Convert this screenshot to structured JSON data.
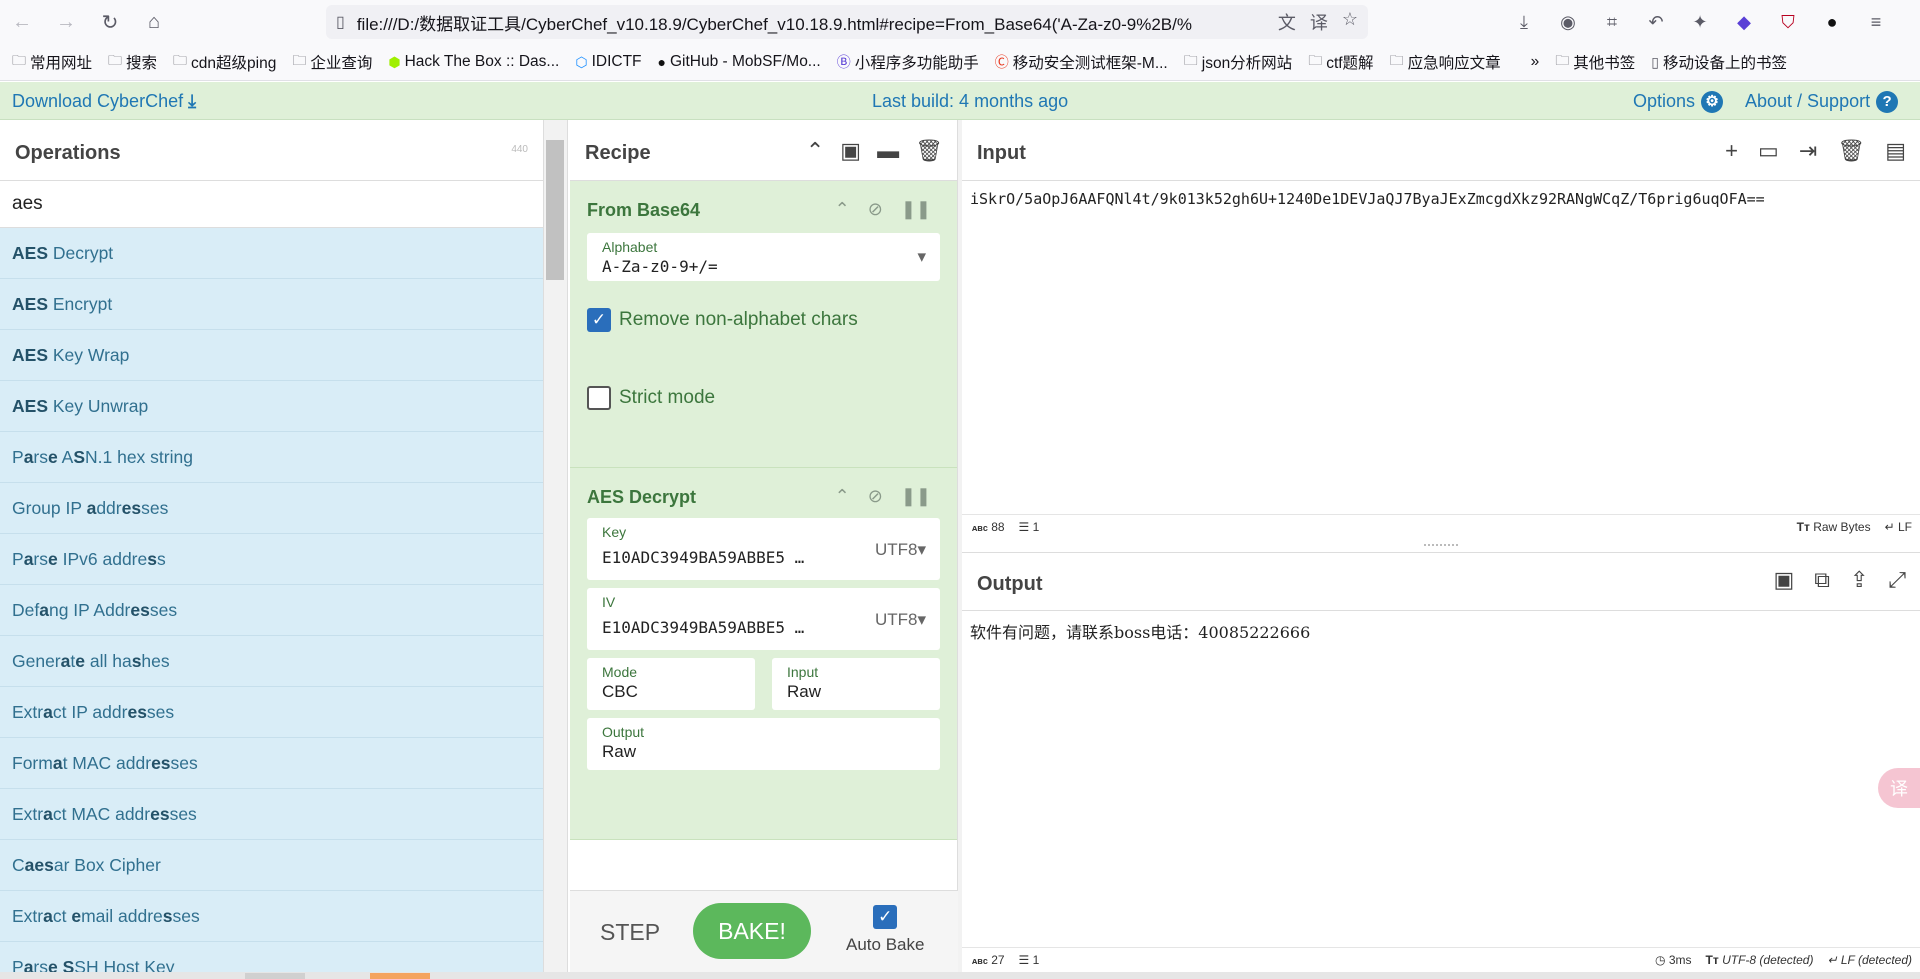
{
  "browser": {
    "url": "file:///D:/数据取证工具/CyberChef_v10.18.9/CyberChef_v10.18.9.html#recipe=From_Base64('A-Za-z0-9%2B/%",
    "bookmarks": [
      "常用网址",
      "搜索",
      "cdn超级ping",
      "企业查询",
      "Hack The Box :: Das...",
      "IDICTF",
      "GitHub - MobSF/Mo...",
      "小程序多功能助手",
      "移动安全测试框架-M...",
      "json分析网站",
      "ctf题解",
      "应急响应文章",
      "其他书签",
      "移动设备上的书签"
    ]
  },
  "banner": {
    "download": "Download CyberChef",
    "build": "Last build: 4 months ago",
    "options": "Options",
    "about": "About / Support"
  },
  "operations": {
    "title": "Operations",
    "count": "440",
    "search_value": "aes",
    "items": [
      "AES Decrypt",
      "AES Encrypt",
      "AES Key Wrap",
      "AES Key Unwrap",
      "Parse ASN.1 hex string",
      "Group IP addresses",
      "Parse IPv6 address",
      "Defang IP Addresses",
      "Generate all hashes",
      "Extract IP addresses",
      "Format MAC addresses",
      "Extract MAC addresses",
      "Caesar Box Cipher",
      "Extract email addresses",
      "Parse SSH Host Key"
    ]
  },
  "recipe": {
    "title": "Recipe",
    "from_base64": {
      "title": "From Base64",
      "alphabet_label": "Alphabet",
      "alphabet_value": "A-Za-z0-9+/=",
      "remove_label": "Remove non-alphabet chars",
      "strict_label": "Strict mode"
    },
    "aes_decrypt": {
      "title": "AES Decrypt",
      "key_label": "Key",
      "key_value": "E10ADC3949BA59ABBE5 …",
      "key_enc": "UTF8",
      "iv_label": "IV",
      "iv_value": "E10ADC3949BA59ABBE5 …",
      "iv_enc": "UTF8",
      "mode_label": "Mode",
      "mode_value": "CBC",
      "input_label": "Input",
      "input_value": "Raw",
      "output_label": "Output",
      "output_value": "Raw"
    },
    "step": "STEP",
    "bake": "BAKE!",
    "autobake": "Auto Bake"
  },
  "input": {
    "title": "Input",
    "text": "iSkrO/5aOpJ6AAFQNl4t/9k013k52gh6U+1240De1DEVJaQJ7ByaJExZmcgdXkz92RANgWCqZ/T6prig6uqOFA==",
    "chars": "88",
    "lines": "1",
    "format": "Raw Bytes",
    "eol": "LF"
  },
  "output": {
    "title": "Output",
    "text": "软件有问题，请联系boss电话：40085222666",
    "chars": "27",
    "lines": "1",
    "time": "3ms",
    "encoding": "UTF-8 (detected)",
    "eol": "LF (detected)"
  }
}
